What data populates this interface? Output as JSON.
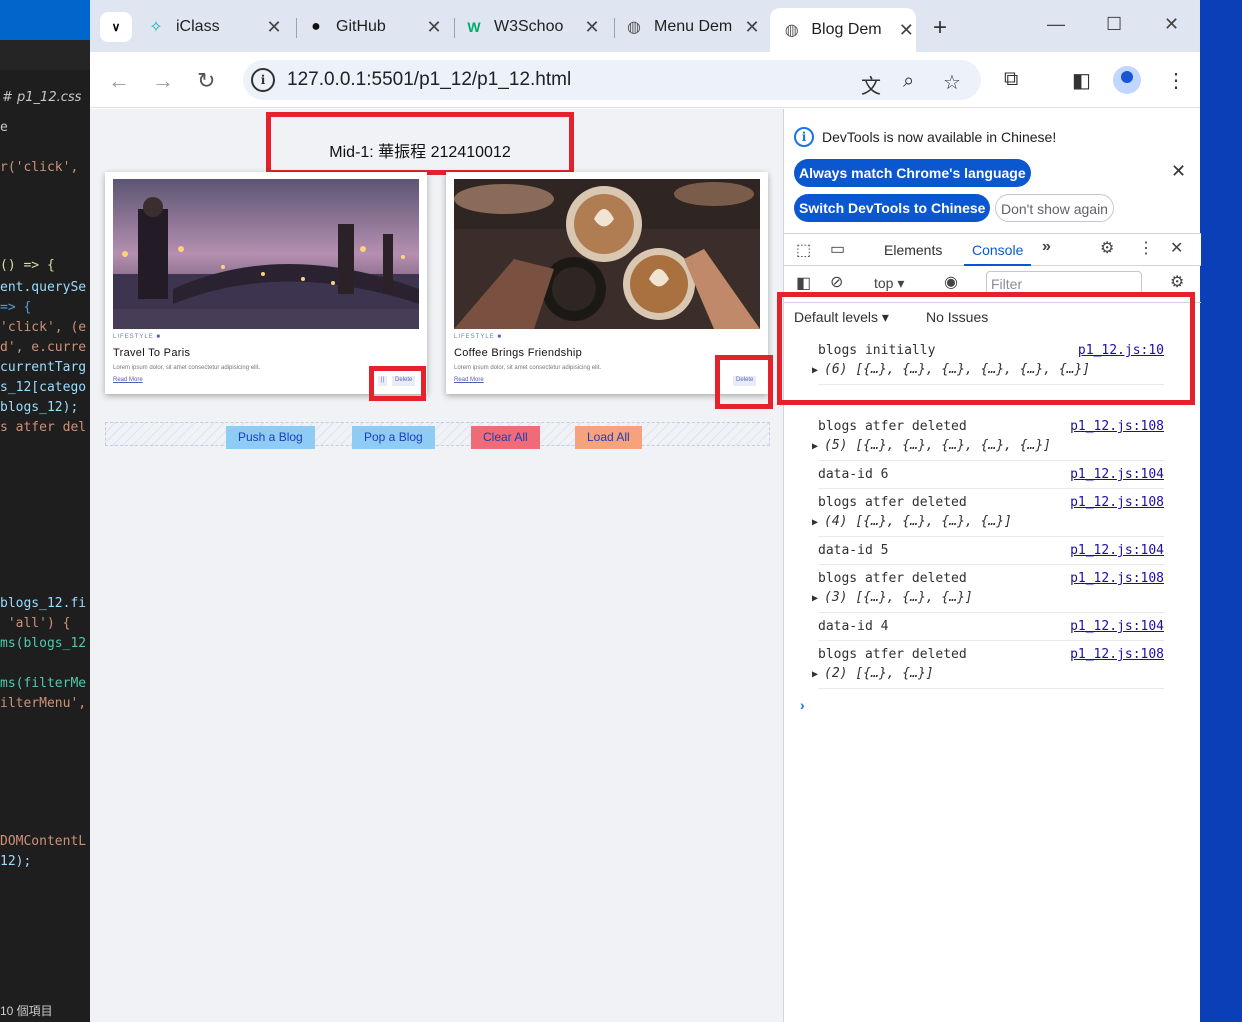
{
  "editor": {
    "tab_label": "# p1_12.css",
    "lines": [
      {
        "text": "e",
        "color": "#c8c8c8"
      },
      {
        "text": "r('click',",
        "color": "#ce9178"
      },
      {
        "text": "() => {",
        "color": "#dcdcaa"
      },
      {
        "text": "ent.querySe",
        "color": "#9cdcfe"
      },
      {
        "text": "=> {",
        "color": "#569cd6"
      },
      {
        "text": "'click', (e",
        "color": "#ce9178"
      },
      {
        "text": "d', e.curre",
        "color": "#ce9178"
      },
      {
        "text": "currentTarg",
        "color": "#9cdcfe"
      },
      {
        "text": "s_12[catego",
        "color": "#9cdcfe"
      },
      {
        "text": "blogs_12);",
        "color": "#9cdcfe"
      },
      {
        "text": "s atfer del",
        "color": "#ce9178"
      },
      {
        "text": "blogs_12.fi",
        "color": "#9cdcfe"
      },
      {
        "text": " 'all') {",
        "color": "#ce9178"
      },
      {
        "text": "ms(blogs_12",
        "color": "#4ec9b0"
      },
      {
        "text": "ms(filterMe",
        "color": "#4ec9b0"
      },
      {
        "text": "ilterMenu',",
        "color": "#ce9178"
      },
      {
        "text": "DOMContentL",
        "color": "#ce9178"
      },
      {
        "text": "12);",
        "color": "#9cdcfe"
      }
    ],
    "status": "10 個項目"
  },
  "browser": {
    "tabs": [
      {
        "title": "iClass",
        "icon": "iclass-icon",
        "color": "#1ab0b0"
      },
      {
        "title": "GitHub",
        "icon": "github-icon",
        "color": "#111111"
      },
      {
        "title": "W3Schoo",
        "icon": "w3schools-icon",
        "color": "#04aa6d"
      },
      {
        "title": "Menu Dem",
        "icon": "globe-icon",
        "color": "#555555"
      },
      {
        "title": "Blog Dem",
        "icon": "globe-icon",
        "color": "#555555"
      }
    ],
    "url": "127.0.0.1:5501/p1_12/p1_12.html"
  },
  "page": {
    "title": "Mid-1: 華振程 212410012",
    "cards": [
      {
        "category": "LIFESTYLE",
        "title": "Travel To Paris",
        "excerpt": "Lorem ipsum dolor, sit amet consectetur adipisicing elit.",
        "read_more": "Read More",
        "delete": "Delete",
        "edit": "||"
      },
      {
        "category": "LIFESTYLE",
        "title": "Coffee Brings Friendship",
        "excerpt": "Lorem ipsum dolor, sit amet consectetur adipisicing elit.",
        "read_more": "Read More",
        "delete": "Delete",
        "edit": ""
      }
    ],
    "buttons": [
      {
        "label": "Push a Blog",
        "bg": "#8ecbf5",
        "color": "#1f3db8"
      },
      {
        "label": "Pop a Blog",
        "bg": "#8ecbf5",
        "color": "#1f3db8"
      },
      {
        "label": "Clear All",
        "bg": "#ef6b77",
        "color": "#1f3db8"
      },
      {
        "label": "Load All",
        "bg": "#f5a37c",
        "color": "#1f3db8"
      }
    ]
  },
  "devtools": {
    "notice": "DevTools is now available in Chinese!",
    "btn_match": "Always match Chrome's language",
    "btn_switch": "Switch DevTools to Chinese",
    "btn_dont_show": "Don't show again",
    "tab_elements": "Elements",
    "tab_console": "Console",
    "context": "top",
    "filter_placeholder": "Filter",
    "levels": "Default levels",
    "issues": "No Issues",
    "logs": [
      {
        "msg": "blogs initially",
        "src": "p1_12.js:10",
        "obj": "(6) [{…}, {…}, {…}, {…}, {…}, {…}]"
      },
      {
        "msg": "blogs atfer deleted",
        "src": "p1_12.js:108",
        "obj": "(5) [{…}, {…}, {…}, {…}, {…}]"
      },
      {
        "msg": "data-id 6",
        "src": "p1_12.js:104",
        "obj": ""
      },
      {
        "msg": "blogs atfer deleted",
        "src": "p1_12.js:108",
        "obj": "(4) [{…}, {…}, {…}, {…}]"
      },
      {
        "msg": "data-id 5",
        "src": "p1_12.js:104",
        "obj": ""
      },
      {
        "msg": "blogs atfer deleted",
        "src": "p1_12.js:108",
        "obj": "(3) [{…}, {…}, {…}]"
      },
      {
        "msg": "data-id 4",
        "src": "p1_12.js:104",
        "obj": ""
      },
      {
        "msg": "blogs atfer deleted",
        "src": "p1_12.js:108",
        "obj": "(2) [{…}, {…}]"
      }
    ]
  }
}
